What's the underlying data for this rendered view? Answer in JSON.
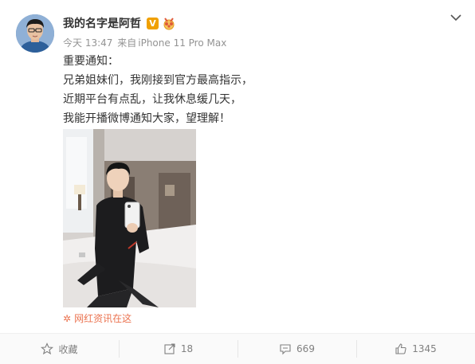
{
  "post": {
    "author": {
      "name": "我的名字是阿哲",
      "verified_badge": "V"
    },
    "meta": {
      "time": "今天 13:47",
      "from_prefix": "来自",
      "device": "iPhone 11 Pro Max"
    },
    "content_lines": [
      "重要通知：",
      "兄弟姐妹们，我刚接到官方最高指示，",
      "近期平台有点乱，让我休息缓几天，",
      "我能开播微博通知大家，望理解！"
    ],
    "source_label": "网红资讯在这"
  },
  "actions": {
    "favorite_label": "收藏",
    "repost_count": "18",
    "comment_count": "669",
    "like_count": "1345"
  },
  "colors": {
    "accent": "#eb7350",
    "verified": "#f0a000",
    "meta_text": "#939393",
    "action_text": "#808080"
  },
  "icons": [
    "user-avatar",
    "verified-v-badge",
    "medal-badge-icon",
    "chevron-down-icon",
    "star-icon",
    "repost-icon",
    "comment-icon",
    "thumbs-up-icon"
  ]
}
